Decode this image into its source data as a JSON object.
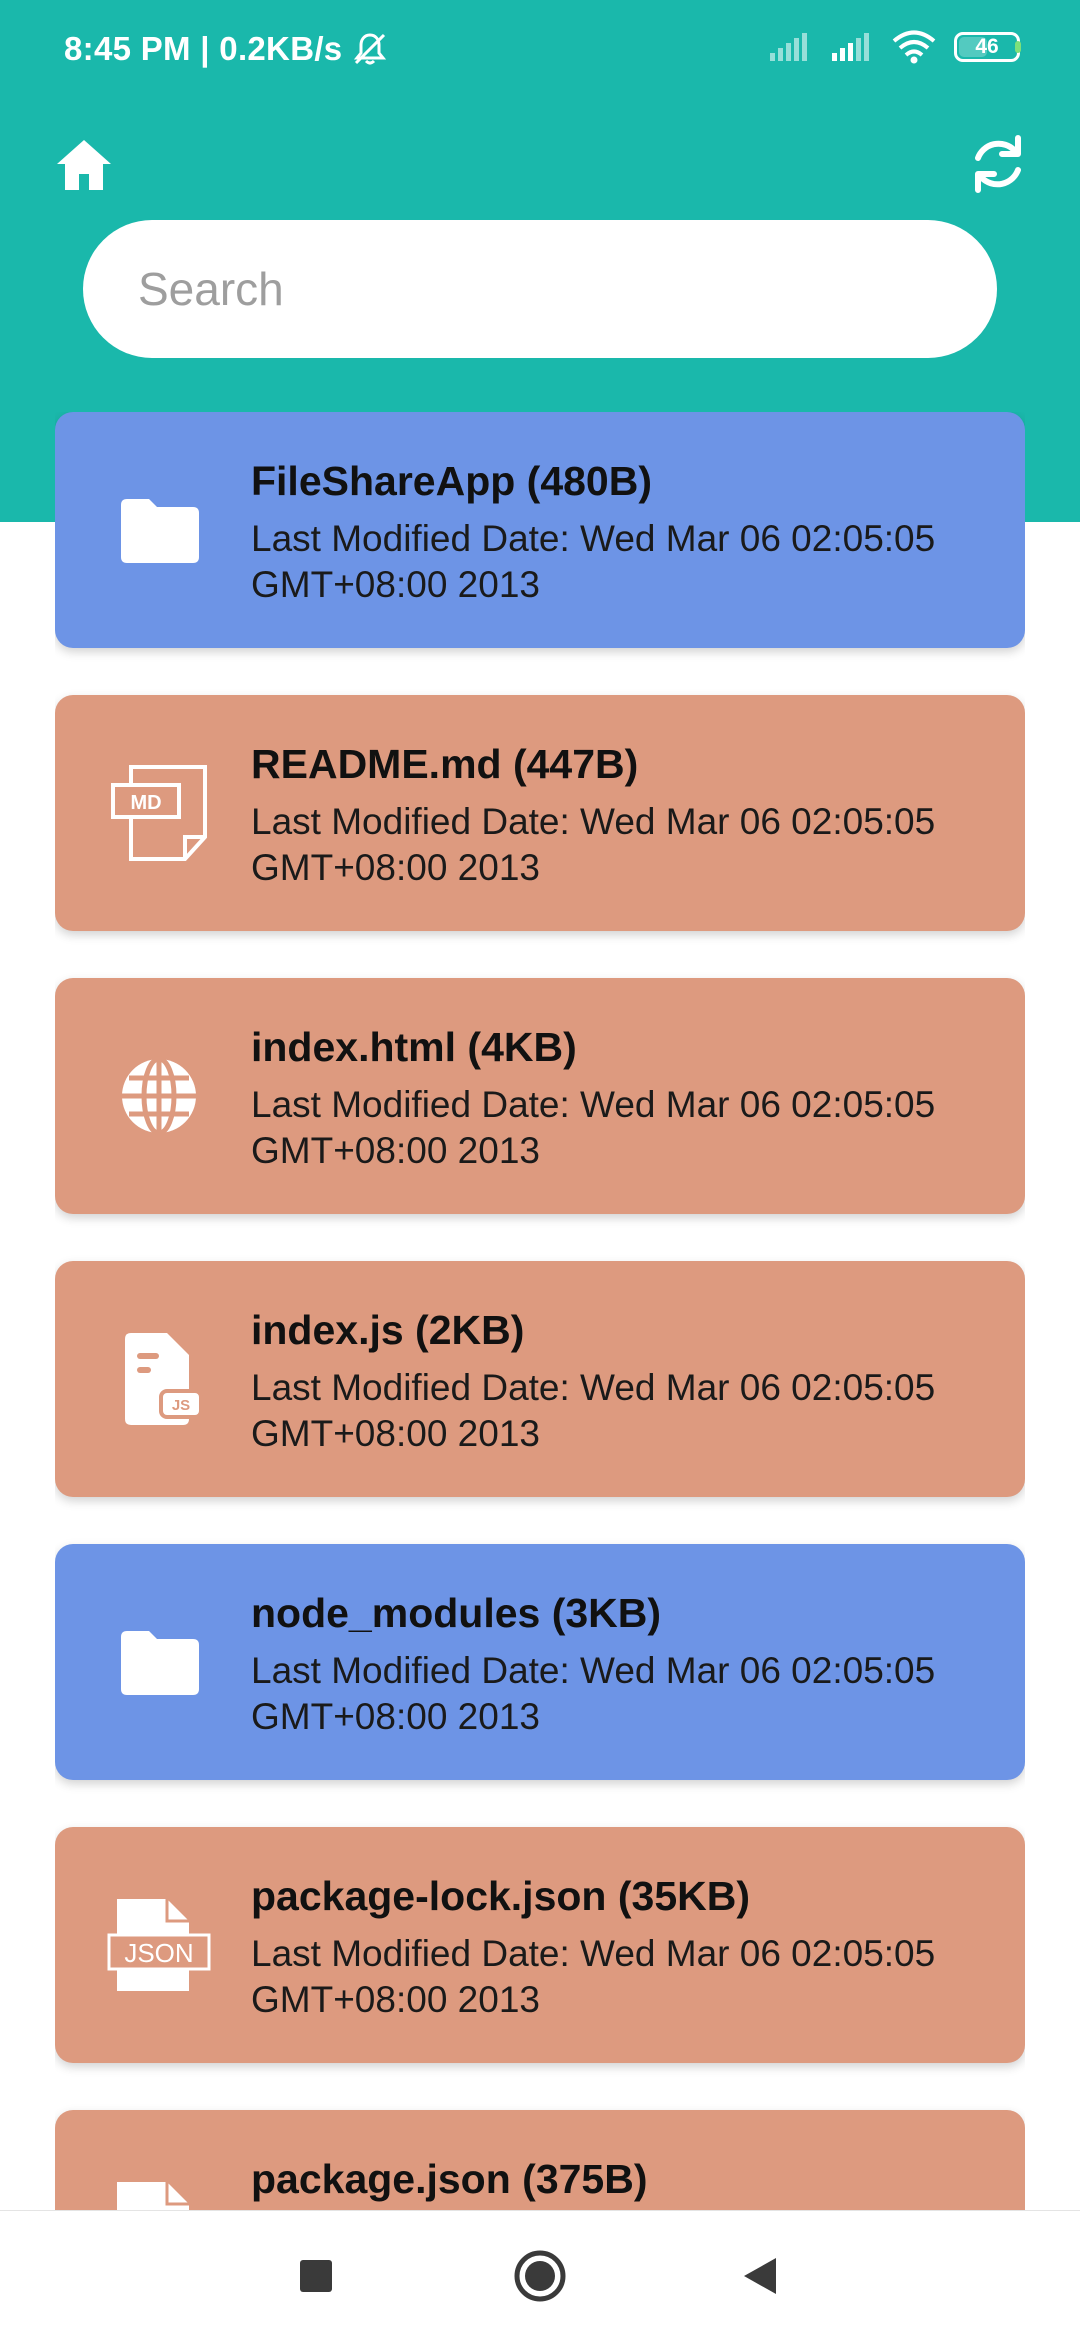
{
  "status_bar": {
    "time_speed": "8:45 PM | 0.2KB/s",
    "battery": "46"
  },
  "header": {
    "home_icon": "home-icon",
    "refresh_icon": "refresh-icon"
  },
  "search": {
    "placeholder": "Search",
    "value": ""
  },
  "files": [
    {
      "name": "FileShareApp (480B)",
      "type": "folder",
      "icon": "folder-icon",
      "modified_line1": "Last Modified Date: Wed Mar 06 02:05:05",
      "modified_line2": "GMT+08:00 2013"
    },
    {
      "name": "README.md (447B)",
      "type": "file",
      "icon": "md-file-icon",
      "icon_text": "MD",
      "modified_line1": "Last Modified Date: Wed Mar 06 02:05:05",
      "modified_line2": "GMT+08:00 2013"
    },
    {
      "name": "index.html (4KB)",
      "type": "file",
      "icon": "globe-icon",
      "modified_line1": "Last Modified Date: Wed Mar 06 02:05:05",
      "modified_line2": "GMT+08:00 2013"
    },
    {
      "name": "index.js (2KB)",
      "type": "file",
      "icon": "js-file-icon",
      "icon_text": "JS",
      "modified_line1": "Last Modified Date: Wed Mar 06 02:05:05",
      "modified_line2": "GMT+08:00 2013"
    },
    {
      "name": "node_modules (3KB)",
      "type": "folder",
      "icon": "folder-icon",
      "modified_line1": "Last Modified Date: Wed Mar 06 02:05:05",
      "modified_line2": "GMT+08:00 2013"
    },
    {
      "name": "package-lock.json (35KB)",
      "type": "file",
      "icon": "json-file-icon",
      "icon_text": "JSON",
      "modified_line1": "Last Modified Date: Wed Mar 06 02:05:05",
      "modified_line2": "GMT+08:00 2013"
    },
    {
      "name": "package.json (375B)",
      "type": "file",
      "icon": "json-file-icon",
      "modified_line1": "",
      "modified_line2": ""
    }
  ],
  "colors": {
    "header": "#1ab8ab",
    "folder_card": "#6d94e6",
    "file_card": "#dd9a7f"
  },
  "nav_bar": {
    "recents_icon": "recents-icon",
    "home_icon": "nav-home-icon",
    "back_icon": "back-icon"
  }
}
